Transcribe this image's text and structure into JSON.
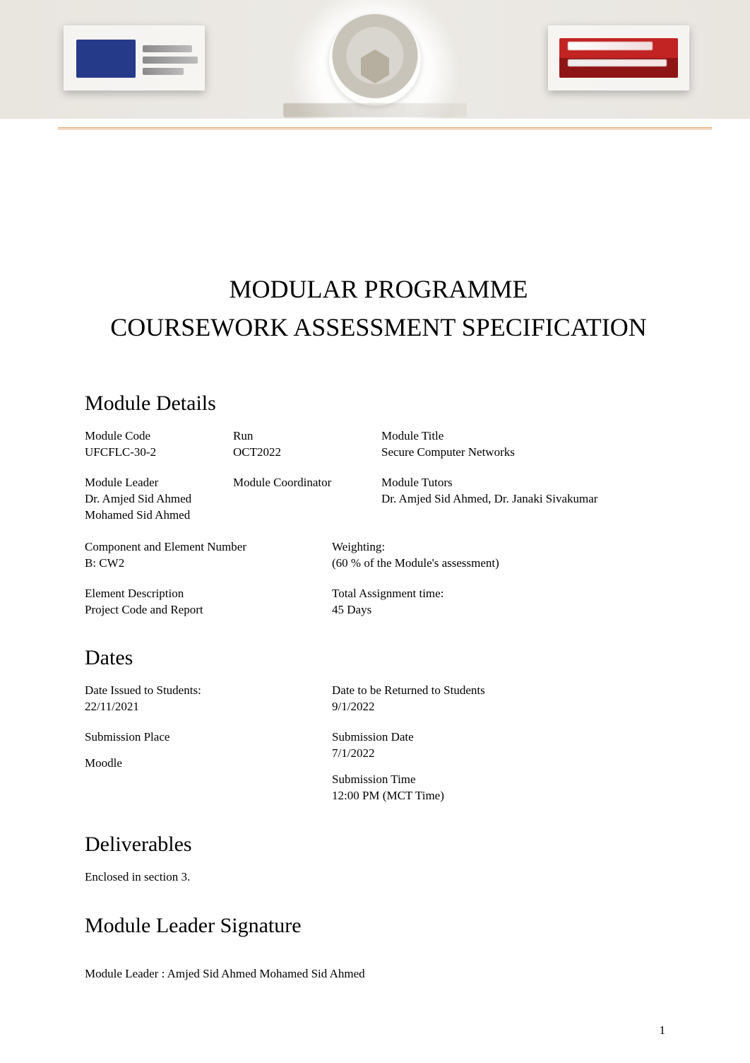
{
  "header": {
    "title_line1": "MODULAR PROGRAMME",
    "title_line2": "COURSEWORK ASSESSMENT SPECIFICATION"
  },
  "sections": {
    "module_details": {
      "heading": "Module Details",
      "rows": [
        {
          "c1_label": "Module Code",
          "c1_value": "UFCFLC-30-2",
          "c2_label": "Run",
          "c2_value": "OCT2022",
          "c3_label": "Module Title",
          "c3_value": "Secure Computer Networks"
        },
        {
          "c1_label": "Module Leader",
          "c1_value": "Dr. Amjed Sid Ahmed Mohamed Sid Ahmed",
          "c2_label": "Module Coordinator",
          "c2_value": "",
          "c3_label": "Module Tutors",
          "c3_value": "Dr. Amjed Sid Ahmed, Dr. Janaki Sivakumar"
        }
      ],
      "rows2": [
        {
          "a_label": "Component and Element Number",
          "a_value": "B: CW2",
          "b_label": "Weighting:",
          "b_value": "(60 % of the Module's assessment)"
        },
        {
          "a_label": "Element Description",
          "a_value": "Project Code and Report",
          "b_label": "Total Assignment time:",
          "b_value": "45 Days"
        }
      ]
    },
    "dates": {
      "heading": "Dates",
      "rows": [
        {
          "a_label": "Date Issued to Students:",
          "a_value": "22/11/2021",
          "b_label": "Date to be Returned to Students",
          "b_value": " 9/1/2022"
        }
      ],
      "left_block": {
        "label": "Submission Place",
        "value_blank": "",
        "value2": "Moodle"
      },
      "right_block": [
        {
          "label": "Submission Date",
          "value": "7/1/2022"
        },
        {
          "label": "Submission Time",
          "value": "12:00 PM (MCT Time)"
        }
      ]
    },
    "deliverables": {
      "heading": "Deliverables",
      "text": "Enclosed in section 3."
    },
    "signature": {
      "heading": "Module Leader Signature",
      "text": "Module Leader :  Amjed Sid Ahmed Mohamed Sid Ahmed"
    }
  },
  "page_number": "1"
}
